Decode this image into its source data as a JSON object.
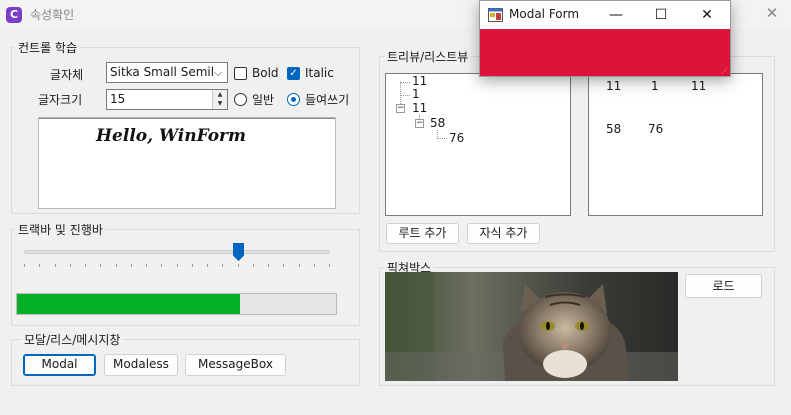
{
  "window": {
    "title": "속성확인",
    "close_glyph": "✕"
  },
  "controls_group": {
    "legend": "컨트롤 학습",
    "font_label": "글자체",
    "font_value": "Sitka Small Semil",
    "bold_label": "Bold",
    "bold_checked": false,
    "italic_label": "Italic",
    "italic_checked": true,
    "size_label": "글자크기",
    "size_value": "15",
    "radio_normal_label": "일반",
    "radio_indent_label": "들여쓰기",
    "selected_radio": "들여쓰기",
    "preview_text": "Hello, WinForm"
  },
  "track_group": {
    "legend": "트랙바 및 진행바",
    "trackbar_value": 0.7,
    "progress_value": 0.7,
    "progress_color": "#06b025"
  },
  "modal_group": {
    "legend": "모달/리스/메시지창",
    "modal_label": "Modal",
    "modaless_label": "Modaless",
    "messagebox_label": "MessageBox"
  },
  "tree_group": {
    "legend": "트리뷰/리스트뷰",
    "tree": [
      "11",
      "1",
      "11",
      "58",
      "76"
    ],
    "list_row1": [
      "11",
      "1",
      "11"
    ],
    "list_row2": [
      "58",
      "76"
    ],
    "add_root_label": "루트 추가",
    "add_child_label": "자식 추가"
  },
  "picture_group": {
    "legend": "픽쳐박스",
    "load_label": "로드",
    "image_subject": "tabby-cat"
  },
  "modal_form": {
    "title": "Modal Form",
    "minimize_glyph": "—",
    "maximize_glyph": "☐",
    "close_glyph": "✕",
    "body_color": "#dc143c"
  },
  "colors": {
    "accent": "#0067c0",
    "progress": "#06b025",
    "modal_body": "#dc143c"
  }
}
